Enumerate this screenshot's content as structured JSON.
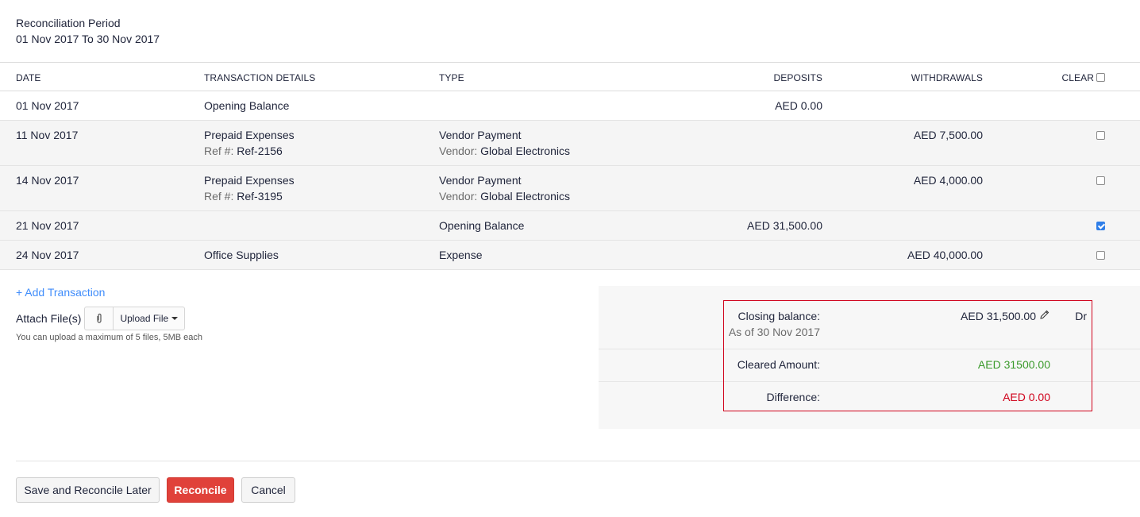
{
  "period": {
    "label": "Reconciliation Period",
    "value": "01 Nov 2017 To 30 Nov 2017"
  },
  "columns": {
    "date": "DATE",
    "details": "TRANSACTION DETAILS",
    "type": "TYPE",
    "deposits": "DEPOSITS",
    "withdrawals": "WITHDRAWALS",
    "clear": "CLEAR"
  },
  "rows": [
    {
      "date": "01 Nov 2017",
      "details": "Opening Balance",
      "ref_label": "",
      "ref": "",
      "type": "",
      "vendor_label": "",
      "vendor": "",
      "deposit": "AED 0.00",
      "withdrawal": "",
      "cleared": null
    },
    {
      "date": "11 Nov 2017",
      "details": "Prepaid Expenses",
      "ref_label": "Ref #:",
      "ref": "Ref-2156",
      "type": "Vendor Payment",
      "vendor_label": "Vendor:",
      "vendor": "Global Electronics",
      "deposit": "",
      "withdrawal": "AED 7,500.00",
      "cleared": false
    },
    {
      "date": "14 Nov 2017",
      "details": "Prepaid Expenses",
      "ref_label": "Ref #:",
      "ref": "Ref-3195",
      "type": "Vendor Payment",
      "vendor_label": "Vendor:",
      "vendor": "Global Electronics",
      "deposit": "",
      "withdrawal": "AED 4,000.00",
      "cleared": false
    },
    {
      "date": "21 Nov 2017",
      "details": "",
      "ref_label": "",
      "ref": "",
      "type": "Opening Balance",
      "vendor_label": "",
      "vendor": "",
      "deposit": "AED 31,500.00",
      "withdrawal": "",
      "cleared": true
    },
    {
      "date": "24 Nov 2017",
      "details": "Office Supplies",
      "ref_label": "",
      "ref": "",
      "type": "Expense",
      "vendor_label": "",
      "vendor": "",
      "deposit": "",
      "withdrawal": "AED 40,000.00",
      "cleared": false
    }
  ],
  "actions": {
    "add_transaction": "+ Add Transaction",
    "attach_label": "Attach File(s)",
    "upload_file": "Upload File",
    "upload_hint": "You can upload a maximum of 5 files, 5MB each"
  },
  "summary": {
    "closing_label": "Closing balance:",
    "closing_sub": "As of 30 Nov 2017",
    "closing_value": "AED 31,500.00",
    "closing_side": "Dr",
    "cleared_label": "Cleared Amount:",
    "cleared_value": "AED 31500.00",
    "difference_label": "Difference:",
    "difference_value": "AED 0.00",
    "colors": {
      "cleared": "#3a9a2b",
      "difference": "#d0021b",
      "highlight_border": "#d0021b"
    }
  },
  "footer": {
    "save_later": "Save and Reconcile Later",
    "reconcile": "Reconcile",
    "cancel": "Cancel"
  },
  "icons": {
    "edit": "pencil-icon",
    "attach": "paperclip-icon",
    "dropdown": "caret-down-icon"
  }
}
